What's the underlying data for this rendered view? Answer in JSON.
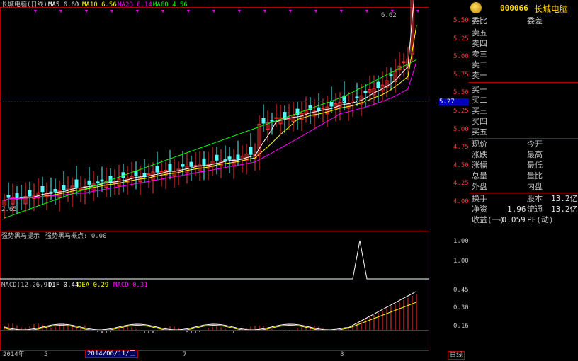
{
  "header": {
    "title": "长城电脑(日线)",
    "ma5": "MA5 6.60",
    "ma10": "MA10 6.56",
    "ma20": "MA20 6.14",
    "ma60": "MA60 4.56"
  },
  "stock": {
    "code": "000066",
    "name": "长城电脑"
  },
  "price_chart": {
    "high_label": "6.62",
    "low_label": "2.65",
    "current_price_tag": "5.27",
    "y_ticks": [
      "5.50",
      "5.25",
      "5.00",
      "5.75",
      "5.50",
      "5.25",
      "5.00",
      "4.75",
      "4.50",
      "4.25",
      "4.00"
    ]
  },
  "indicator": {
    "title": "强势黑马提示",
    "label": "强势黑马概点: 0.00",
    "y_ticks": [
      "1.00",
      "1.00"
    ]
  },
  "macd": {
    "title": "MACD(12,26,9)",
    "dif": "DIF 0.44",
    "dea": "DEA 0.29",
    "macd": "MACD 0.31",
    "y_ticks": [
      "0.45",
      "0.30",
      "0.16"
    ]
  },
  "x_axis": {
    "year": "2014年",
    "m1": "5",
    "date_box": "2014/06/11/三",
    "m2": "7",
    "m3": "8",
    "period": "日线"
  },
  "quote_panel": {
    "order_header_left": "委比",
    "order_header_right": "委差",
    "asks": [
      "卖五",
      "卖四",
      "卖三",
      "卖二",
      "卖一"
    ],
    "bids": [
      "买一",
      "买二",
      "买三",
      "买四",
      "买五"
    ],
    "stats": [
      {
        "l": "现价",
        "r": "今开"
      },
      {
        "l": "涨跌",
        "r": "最高"
      },
      {
        "l": "涨幅",
        "r": "最低"
      },
      {
        "l": "总量",
        "r": "量比"
      },
      {
        "l": "外盘",
        "r": "内盘"
      }
    ],
    "turnover_label": "换手",
    "share_cap_label": "股本",
    "share_cap_value": "13.2亿",
    "net_asset_label": "净资",
    "net_asset_value": "1.96",
    "float_label": "流通",
    "float_value": "13.2亿",
    "profit_label": "收益(一)",
    "profit_value": "-0.059",
    "pe_label": "PE(动)"
  },
  "colors": {
    "up": "#ff3232",
    "down": "#54ffff",
    "ma5": "#ffffff",
    "ma10": "#ffff00",
    "ma20": "#ff00ff",
    "ma60": "#00ff00",
    "axis": "#b00000",
    "code": "#ffd700"
  }
}
